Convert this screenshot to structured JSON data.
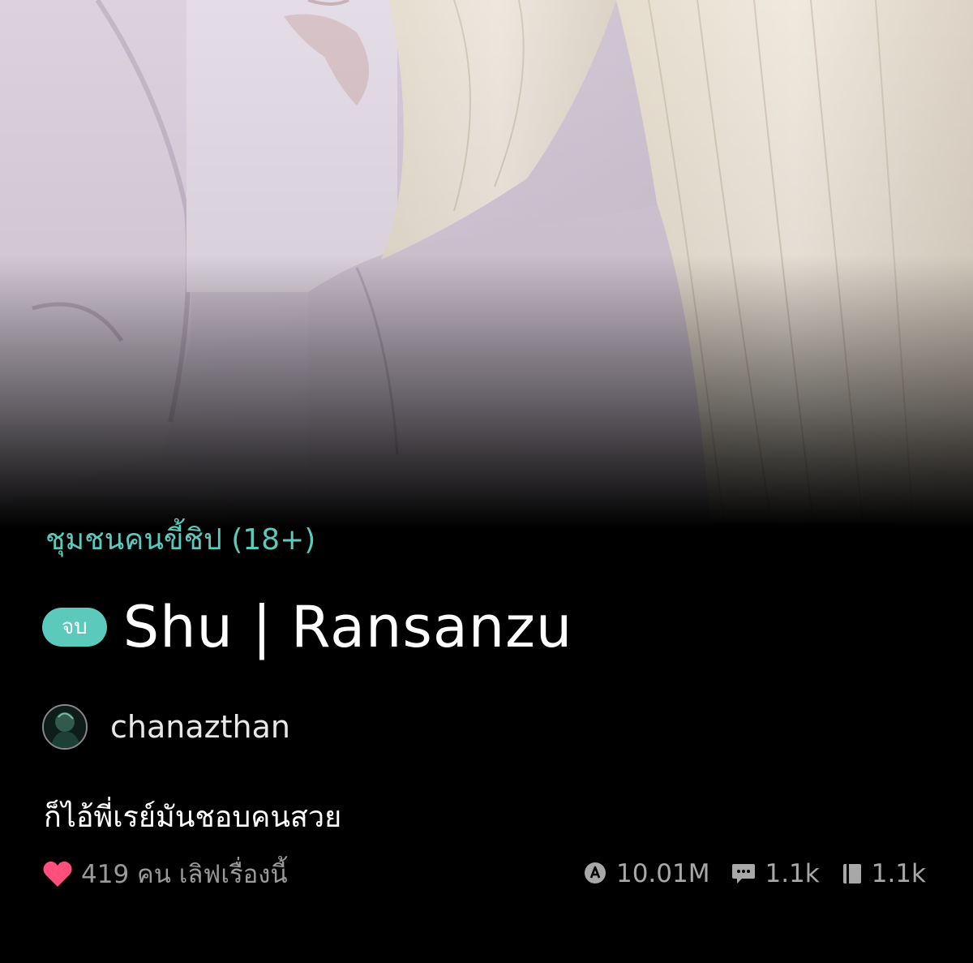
{
  "story": {
    "category": "ชุมชนคนขี้ชิป (18+)",
    "status_badge": "จบ",
    "title": "Shu | Ransanzu",
    "author": "chanazthan",
    "description": "ก็ไอ้พี่เรย์มันชอบคนสวย",
    "likes_text": "419 คน เลิฟเรื่องนี้",
    "stats": {
      "views": "10.01M",
      "comments": "1.1k",
      "chapters": "1.1k"
    }
  },
  "icons": {
    "heart": "heart-icon",
    "views": "views-icon",
    "comments": "comment-icon",
    "chapters": "book-icon"
  },
  "colors": {
    "accent": "#5cc9bd",
    "heart": "#ff4f7a",
    "background": "#000000",
    "muted_text": "#9a9a9a"
  }
}
